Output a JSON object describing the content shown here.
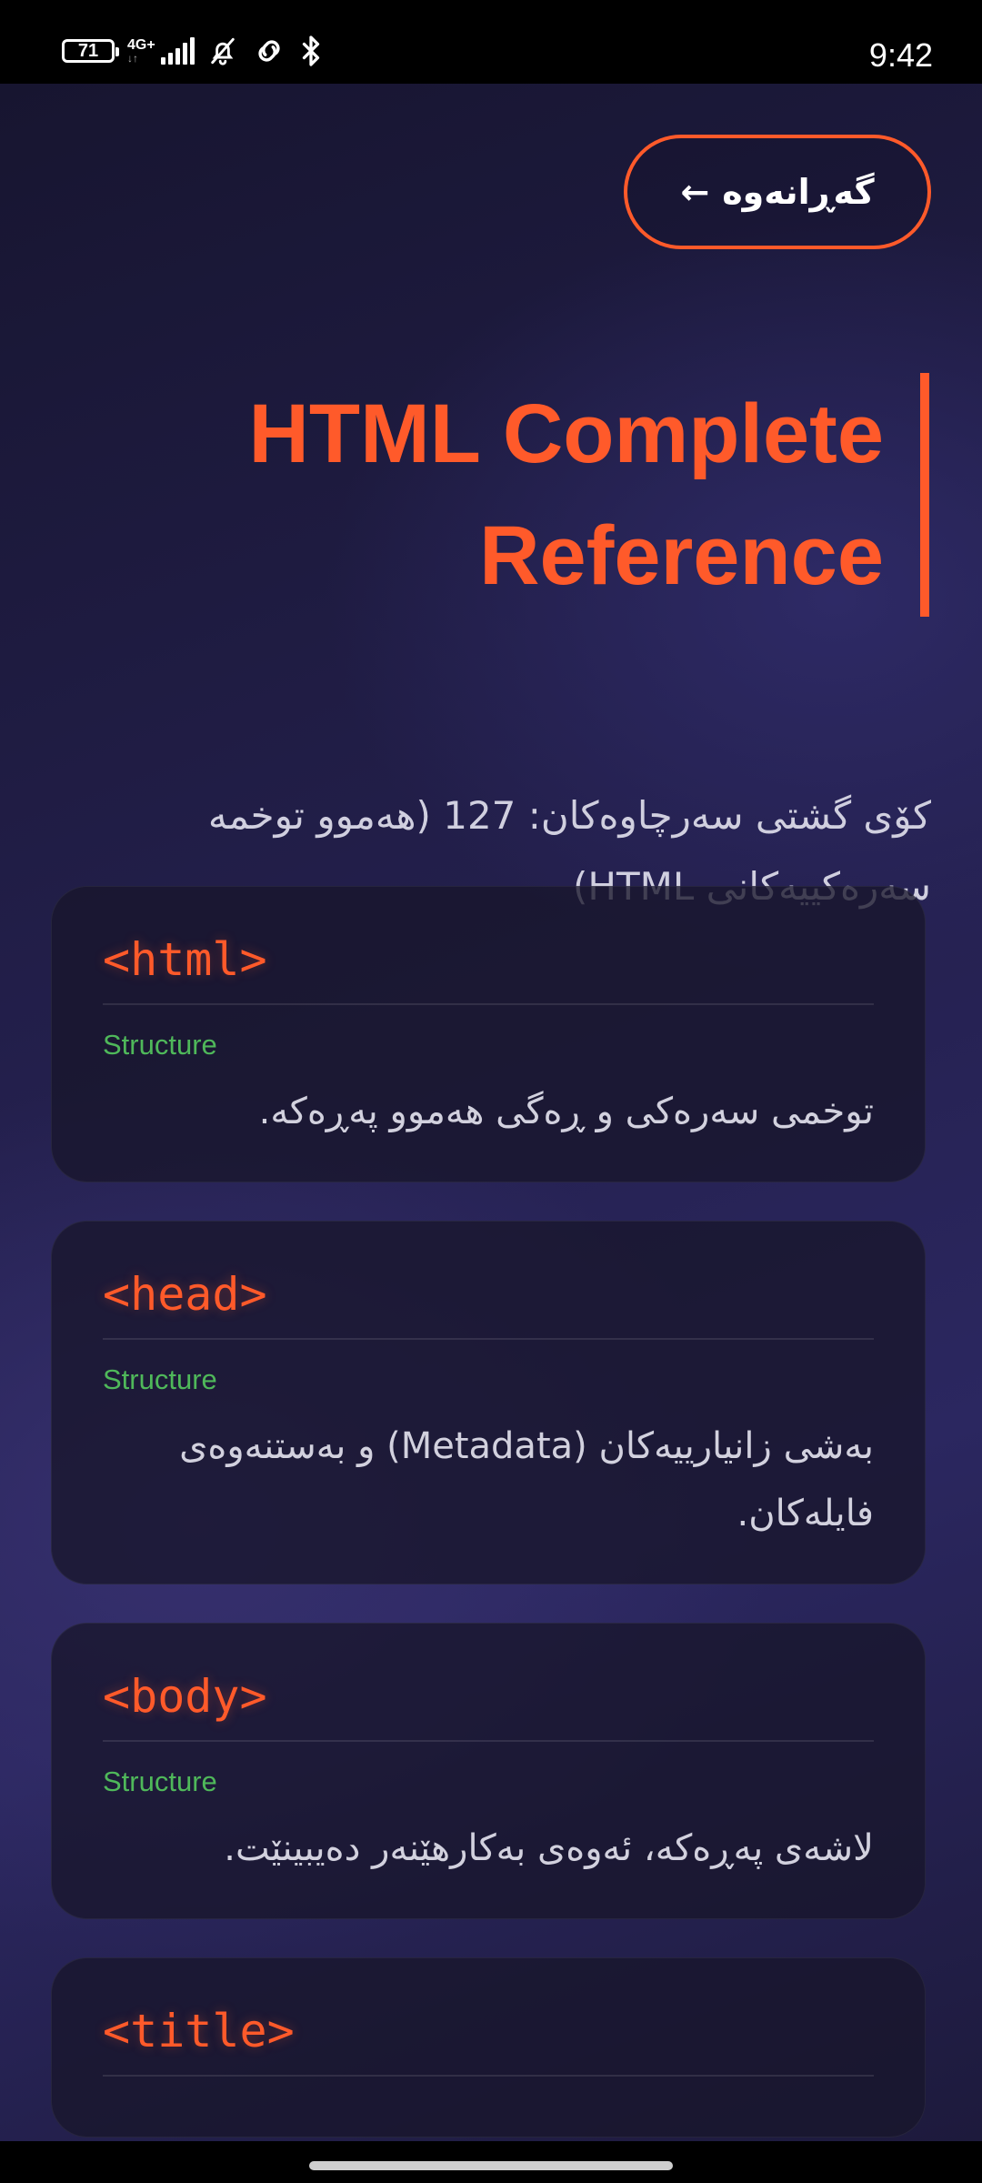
{
  "status_bar": {
    "battery_level": "71",
    "network_type": "4G+",
    "network_arrows": "↓↑",
    "time": "9:42"
  },
  "back_button": {
    "label": "گەڕانەوە",
    "arrow": "←"
  },
  "page_title": "HTML Complete Reference",
  "summary": "کۆی گشتی سەرچاوەکان: 127 (هەموو توخمە سەرەکییەکانی HTML)",
  "colors": {
    "accent": "#ff5a2a",
    "category": "#4fb85a",
    "background": "#24204e",
    "card": "#18162c"
  },
  "cards": [
    {
      "tag": "<html>",
      "category": "Structure",
      "description": "توخمی سەرەکی و ڕەگی هەموو پەڕەکە."
    },
    {
      "tag": "<head>",
      "category": "Structure",
      "description": "بەشی زانیارییەکان (Metadata) و بەستنەوەی فایلەکان."
    },
    {
      "tag": "<body>",
      "category": "Structure",
      "description": "لاشەی پەڕەکە، ئەوەی بەکارهێنەر دەیبینێت."
    },
    {
      "tag": "<title>",
      "category": "",
      "description": ""
    }
  ]
}
